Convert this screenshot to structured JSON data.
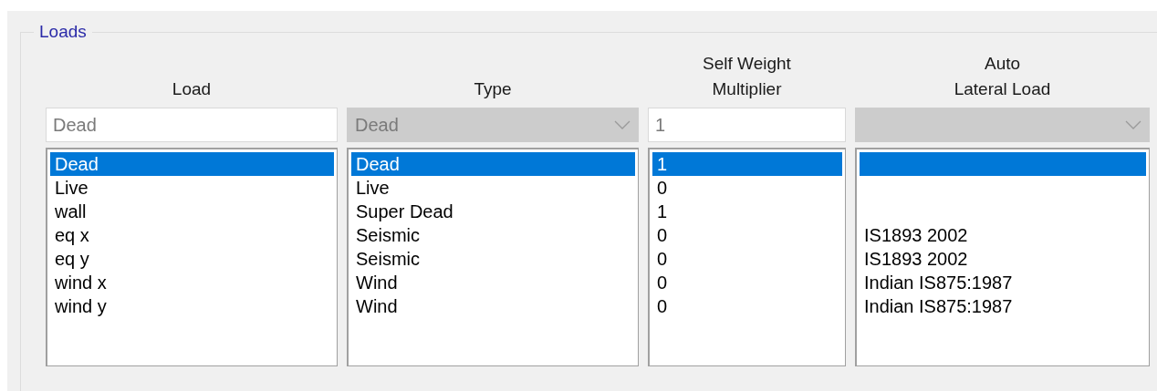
{
  "group": {
    "title": "Loads"
  },
  "columns": [
    {
      "header": [
        "Load"
      ],
      "field": {
        "kind": "text",
        "value": "Dead"
      },
      "items": [
        {
          "text": "Dead",
          "selected": true
        },
        {
          "text": "Live",
          "selected": false
        },
        {
          "text": "wall",
          "selected": false
        },
        {
          "text": "eq x",
          "selected": false
        },
        {
          "text": "eq y",
          "selected": false
        },
        {
          "text": "wind x",
          "selected": false
        },
        {
          "text": "wind y",
          "selected": false
        }
      ]
    },
    {
      "header": [
        "Type"
      ],
      "field": {
        "kind": "dropdown",
        "value": "Dead",
        "disabled": true
      },
      "items": [
        {
          "text": "Dead",
          "selected": true
        },
        {
          "text": "Live",
          "selected": false
        },
        {
          "text": "Super Dead",
          "selected": false
        },
        {
          "text": "Seismic",
          "selected": false
        },
        {
          "text": "Seismic",
          "selected": false
        },
        {
          "text": "Wind",
          "selected": false
        },
        {
          "text": "Wind",
          "selected": false
        }
      ]
    },
    {
      "header": [
        "Self Weight",
        "Multiplier"
      ],
      "field": {
        "kind": "text",
        "value": "1"
      },
      "items": [
        {
          "text": "1",
          "selected": true
        },
        {
          "text": "0",
          "selected": false
        },
        {
          "text": "1",
          "selected": false
        },
        {
          "text": "0",
          "selected": false
        },
        {
          "text": "0",
          "selected": false
        },
        {
          "text": "0",
          "selected": false
        },
        {
          "text": "0",
          "selected": false
        }
      ]
    },
    {
      "header": [
        "Auto",
        "Lateral Load"
      ],
      "field": {
        "kind": "dropdown",
        "disabled": true
      },
      "items": [
        {
          "selected": true
        },
        {
          "selected": false
        },
        {
          "selected": false
        },
        {
          "text": "IS1893 2002",
          "selected": false
        },
        {
          "text": "IS1893 2002",
          "selected": false
        },
        {
          "text": "Indian IS875:1987",
          "selected": false
        },
        {
          "text": "Indian IS875:1987",
          "selected": false
        }
      ]
    }
  ]
}
